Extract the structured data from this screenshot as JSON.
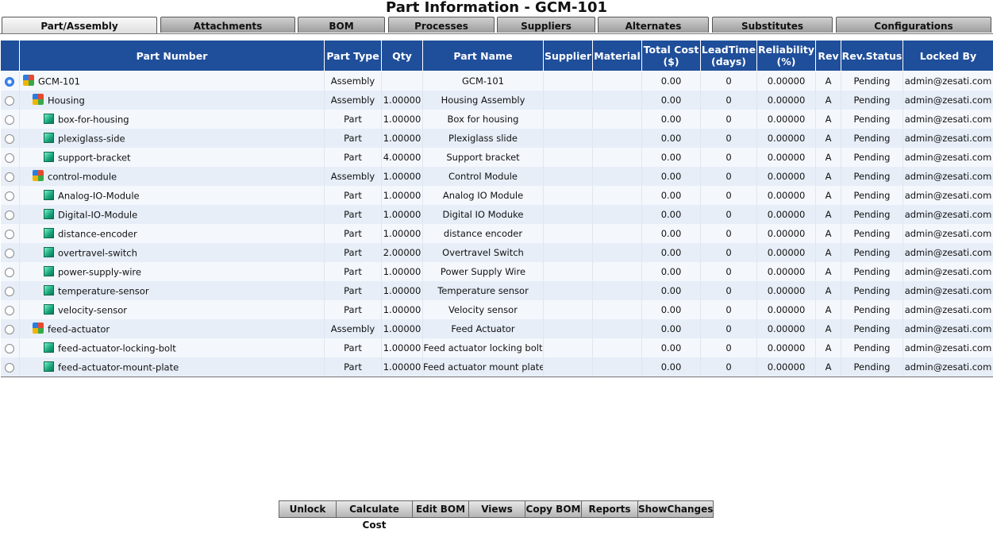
{
  "title": "Part Information - GCM-101",
  "tabs": [
    {
      "label": "Part/Assembly",
      "active": true
    },
    {
      "label": "Attachments",
      "active": false
    },
    {
      "label": "BOM",
      "active": false
    },
    {
      "label": "Processes",
      "active": false
    },
    {
      "label": "Suppliers",
      "active": false
    },
    {
      "label": "Alternates",
      "active": false
    },
    {
      "label": "Substitutes",
      "active": false
    },
    {
      "label": "Configurations",
      "active": false
    }
  ],
  "columns": [
    "Part Number",
    "Part Type",
    "Qty",
    "Part Name",
    "Supplier",
    "Material",
    "Total Cost ($)",
    "LeadTime (days)",
    "Reliability (%)",
    "Rev",
    "Rev.Status",
    "Locked By"
  ],
  "rows": [
    {
      "selected": true,
      "level": 0,
      "icon": "assembly-icon",
      "part_number": "GCM-101",
      "part_type": "Assembly",
      "qty": "",
      "part_name": "GCM-101",
      "supplier": "",
      "material": "",
      "total_cost": "0.00",
      "lead_time": "0",
      "reliability": "0.00000",
      "rev": "A",
      "rev_status": "Pending",
      "locked_by": "admin@zesati.com"
    },
    {
      "selected": false,
      "level": 1,
      "icon": "assembly-icon",
      "part_number": "Housing",
      "part_type": "Assembly",
      "qty": "1.00000",
      "part_name": "Housing Assembly",
      "supplier": "",
      "material": "",
      "total_cost": "0.00",
      "lead_time": "0",
      "reliability": "0.00000",
      "rev": "A",
      "rev_status": "Pending",
      "locked_by": "admin@zesati.com"
    },
    {
      "selected": false,
      "level": 2,
      "icon": "part-icon",
      "part_number": "box-for-housing",
      "part_type": "Part",
      "qty": "1.00000",
      "part_name": "Box for housing",
      "supplier": "",
      "material": "",
      "total_cost": "0.00",
      "lead_time": "0",
      "reliability": "0.00000",
      "rev": "A",
      "rev_status": "Pending",
      "locked_by": "admin@zesati.com"
    },
    {
      "selected": false,
      "level": 2,
      "icon": "part-icon",
      "part_number": "plexiglass-side",
      "part_type": "Part",
      "qty": "1.00000",
      "part_name": "Plexiglass slide",
      "supplier": "",
      "material": "",
      "total_cost": "0.00",
      "lead_time": "0",
      "reliability": "0.00000",
      "rev": "A",
      "rev_status": "Pending",
      "locked_by": "admin@zesati.com"
    },
    {
      "selected": false,
      "level": 2,
      "icon": "part-icon",
      "part_number": "support-bracket",
      "part_type": "Part",
      "qty": "4.00000",
      "part_name": "Support bracket",
      "supplier": "",
      "material": "",
      "total_cost": "0.00",
      "lead_time": "0",
      "reliability": "0.00000",
      "rev": "A",
      "rev_status": "Pending",
      "locked_by": "admin@zesati.com"
    },
    {
      "selected": false,
      "level": 1,
      "icon": "assembly-icon",
      "part_number": "control-module",
      "part_type": "Assembly",
      "qty": "1.00000",
      "part_name": "Control Module",
      "supplier": "",
      "material": "",
      "total_cost": "0.00",
      "lead_time": "0",
      "reliability": "0.00000",
      "rev": "A",
      "rev_status": "Pending",
      "locked_by": "admin@zesati.com"
    },
    {
      "selected": false,
      "level": 2,
      "icon": "part-icon",
      "part_number": "Analog-IO-Module",
      "part_type": "Part",
      "qty": "1.00000",
      "part_name": "Analog IO Module",
      "supplier": "",
      "material": "",
      "total_cost": "0.00",
      "lead_time": "0",
      "reliability": "0.00000",
      "rev": "A",
      "rev_status": "Pending",
      "locked_by": "admin@zesati.com"
    },
    {
      "selected": false,
      "level": 2,
      "icon": "part-icon",
      "part_number": "Digital-IO-Module",
      "part_type": "Part",
      "qty": "1.00000",
      "part_name": "Digital IO Moduke",
      "supplier": "",
      "material": "",
      "total_cost": "0.00",
      "lead_time": "0",
      "reliability": "0.00000",
      "rev": "A",
      "rev_status": "Pending",
      "locked_by": "admin@zesati.com"
    },
    {
      "selected": false,
      "level": 2,
      "icon": "part-icon",
      "part_number": "distance-encoder",
      "part_type": "Part",
      "qty": "1.00000",
      "part_name": "distance encoder",
      "supplier": "",
      "material": "",
      "total_cost": "0.00",
      "lead_time": "0",
      "reliability": "0.00000",
      "rev": "A",
      "rev_status": "Pending",
      "locked_by": "admin@zesati.com"
    },
    {
      "selected": false,
      "level": 2,
      "icon": "part-icon",
      "part_number": "overtravel-switch",
      "part_type": "Part",
      "qty": "2.00000",
      "part_name": "Overtravel Switch",
      "supplier": "",
      "material": "",
      "total_cost": "0.00",
      "lead_time": "0",
      "reliability": "0.00000",
      "rev": "A",
      "rev_status": "Pending",
      "locked_by": "admin@zesati.com"
    },
    {
      "selected": false,
      "level": 2,
      "icon": "part-icon",
      "part_number": "power-supply-wire",
      "part_type": "Part",
      "qty": "1.00000",
      "part_name": "Power Supply Wire",
      "supplier": "",
      "material": "",
      "total_cost": "0.00",
      "lead_time": "0",
      "reliability": "0.00000",
      "rev": "A",
      "rev_status": "Pending",
      "locked_by": "admin@zesati.com"
    },
    {
      "selected": false,
      "level": 2,
      "icon": "part-icon",
      "part_number": "temperature-sensor",
      "part_type": "Part",
      "qty": "1.00000",
      "part_name": "Temperature sensor",
      "supplier": "",
      "material": "",
      "total_cost": "0.00",
      "lead_time": "0",
      "reliability": "0.00000",
      "rev": "A",
      "rev_status": "Pending",
      "locked_by": "admin@zesati.com"
    },
    {
      "selected": false,
      "level": 2,
      "icon": "part-icon",
      "part_number": "velocity-sensor",
      "part_type": "Part",
      "qty": "1.00000",
      "part_name": "Velocity sensor",
      "supplier": "",
      "material": "",
      "total_cost": "0.00",
      "lead_time": "0",
      "reliability": "0.00000",
      "rev": "A",
      "rev_status": "Pending",
      "locked_by": "admin@zesati.com"
    },
    {
      "selected": false,
      "level": 1,
      "icon": "assembly-icon",
      "part_number": "feed-actuator",
      "part_type": "Assembly",
      "qty": "1.00000",
      "part_name": "Feed Actuator",
      "supplier": "",
      "material": "",
      "total_cost": "0.00",
      "lead_time": "0",
      "reliability": "0.00000",
      "rev": "A",
      "rev_status": "Pending",
      "locked_by": "admin@zesati.com"
    },
    {
      "selected": false,
      "level": 2,
      "icon": "part-icon",
      "part_number": "feed-actuator-locking-bolt",
      "part_type": "Part",
      "qty": "1.00000",
      "part_name": "Feed actuator locking bolt",
      "supplier": "",
      "material": "",
      "total_cost": "0.00",
      "lead_time": "0",
      "reliability": "0.00000",
      "rev": "A",
      "rev_status": "Pending",
      "locked_by": "admin@zesati.com"
    },
    {
      "selected": false,
      "level": 2,
      "icon": "part-icon",
      "part_number": "feed-actuator-mount-plate",
      "part_type": "Part",
      "qty": "1.00000",
      "part_name": "Feed actuator mount plate",
      "supplier": "",
      "material": "",
      "total_cost": "0.00",
      "lead_time": "0",
      "reliability": "0.00000",
      "rev": "A",
      "rev_status": "Pending",
      "locked_by": "admin@zesati.com"
    }
  ],
  "buttons": [
    "Unlock",
    "Calculate Cost",
    "Edit BOM",
    "Views",
    "Copy BOM",
    "Reports",
    "ShowChanges"
  ],
  "colors": {
    "header_bg": "#1f4e9a",
    "row_odd": "#f4f8fd",
    "row_even": "#e7eef8"
  }
}
